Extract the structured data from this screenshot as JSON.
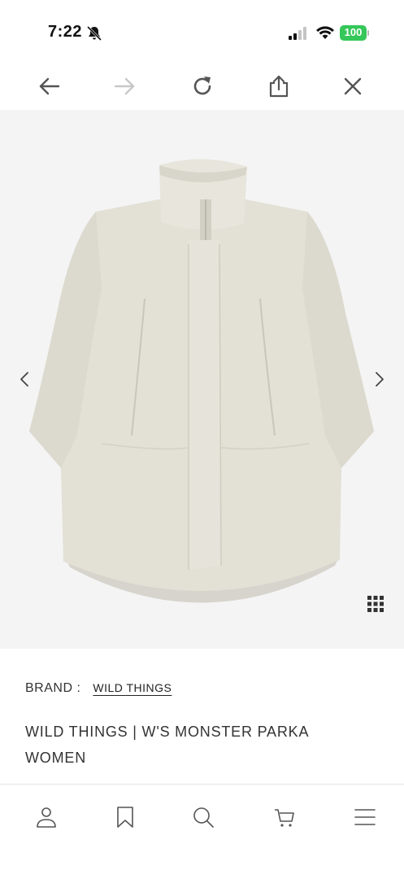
{
  "status_bar": {
    "time": "7:22",
    "battery": "100",
    "icons": [
      "bell-slash-icon",
      "signal-icon",
      "wifi-icon",
      "battery-icon"
    ],
    "battery_color": "#35c759"
  },
  "toolbar": {
    "buttons": [
      "back-icon",
      "forward-icon",
      "reload-icon",
      "share-icon",
      "close-icon"
    ]
  },
  "product_image": {
    "background": "#f4f4f4",
    "icons": [
      "chevron-left-icon",
      "chevron-right-icon",
      "grid-icon"
    ]
  },
  "product": {
    "brand_label": "BRAND :",
    "brand_name": "WILD THINGS",
    "name_line1": "WILD THINGS | W'S MONSTER PARKA",
    "name_line2": "WOMEN"
  },
  "bottom_nav": {
    "items": [
      "user-icon",
      "bookmark-icon",
      "search-icon",
      "cart-icon",
      "menu-icon"
    ]
  }
}
